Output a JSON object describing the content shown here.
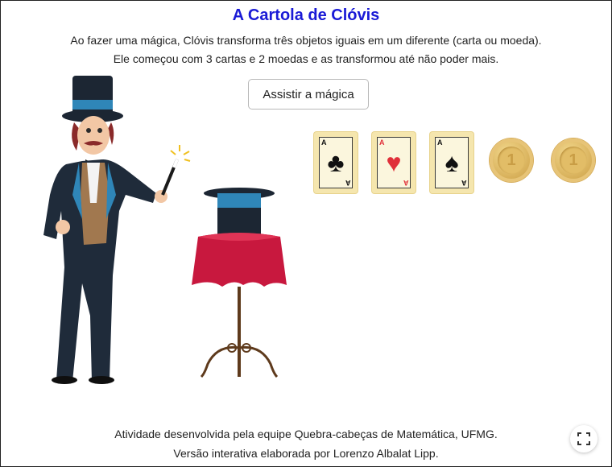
{
  "header": {
    "title": "A Cartola de Clóvis",
    "line1": "Ao fazer uma mágica, Clóvis transforma três objetos iguais em um diferente (carta ou moeda).",
    "line2": "Ele começou com 3 cartas e 2 moedas e as transformou até não poder mais."
  },
  "controls": {
    "play_label": "Assistir a mágica"
  },
  "items": {
    "cards": [
      {
        "corner": "A",
        "suit": "♣",
        "color": "#111111"
      },
      {
        "corner": "A",
        "suit": "♥",
        "color": "#e0303a"
      },
      {
        "corner": "A",
        "suit": "♠",
        "color": "#111111"
      }
    ],
    "coins": [
      {
        "mark": "1"
      },
      {
        "mark": "1"
      }
    ]
  },
  "footer": {
    "line1": "Atividade desenvolvida pela equipe Quebra-cabeças de Matemática, UFMG.",
    "line2": "Versão interativa elaborada por Lorenzo Albalat Lipp."
  },
  "icons": {
    "fullscreen": "fullscreen-icon"
  },
  "colors": {
    "title": "#1a1ad6",
    "card_bg": "#f5e6ae",
    "coin": "#d9b25c",
    "tablecloth": "#c8183e"
  }
}
